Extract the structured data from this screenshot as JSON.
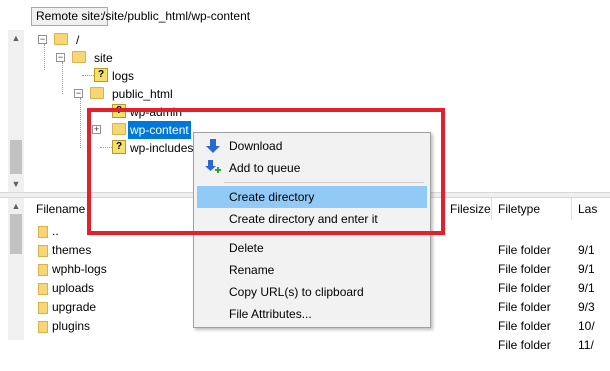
{
  "path_bar": {
    "site_label": "Remote site:",
    "path": "/site/public_html/wp-content"
  },
  "tree": {
    "nodes": [
      {
        "label": "/",
        "icon": "folder-icon"
      },
      {
        "label": "site",
        "icon": "folder-icon"
      },
      {
        "label": "logs",
        "icon": "unknown-folder-icon"
      },
      {
        "label": "public_html",
        "icon": "folder-icon"
      },
      {
        "label": "wp-admin",
        "icon": "unknown-folder-icon"
      },
      {
        "label": "wp-content",
        "icon": "folder-icon",
        "selected": true
      },
      {
        "label": "wp-includes",
        "icon": "unknown-folder-icon"
      }
    ],
    "expand_minus": "−",
    "expand_plus": "+"
  },
  "file_list": {
    "columns": {
      "filename": "Filename",
      "filesize": "Filesize",
      "filetype": "Filetype",
      "last": "Las"
    },
    "rows": [
      {
        "name": "..",
        "type": "",
        "date": ""
      },
      {
        "name": "themes",
        "type": "File folder",
        "date": "9/1"
      },
      {
        "name": "wphb-logs",
        "type": "File folder",
        "date": "9/1"
      },
      {
        "name": "uploads",
        "type": "File folder",
        "date": "9/1"
      },
      {
        "name": "upgrade",
        "type": "File folder",
        "date": "9/3"
      },
      {
        "name": "plugins",
        "type": "File folder",
        "date": "10/"
      },
      {
        "name": "",
        "type": "File folder",
        "date": "11/"
      }
    ]
  },
  "context_menu": {
    "items": [
      {
        "label": "Download",
        "icon": "download-icon"
      },
      {
        "label": "Add to queue",
        "icon": "add-to-queue-icon"
      },
      {
        "label": "Create directory",
        "highlighted": true
      },
      {
        "label": "Create directory and enter it"
      },
      {
        "label": "Delete"
      },
      {
        "label": "Rename"
      },
      {
        "label": "Copy URL(s) to clipboard"
      },
      {
        "label": "File Attributes..."
      }
    ]
  },
  "scrollbar": {
    "up_arrow": "▲",
    "down_arrow": "▼"
  },
  "colors": {
    "selection": "#0078d7",
    "menu_highlight": "#91c9f7",
    "annotation_box": "#e3202b",
    "folder": "#f7d675"
  }
}
